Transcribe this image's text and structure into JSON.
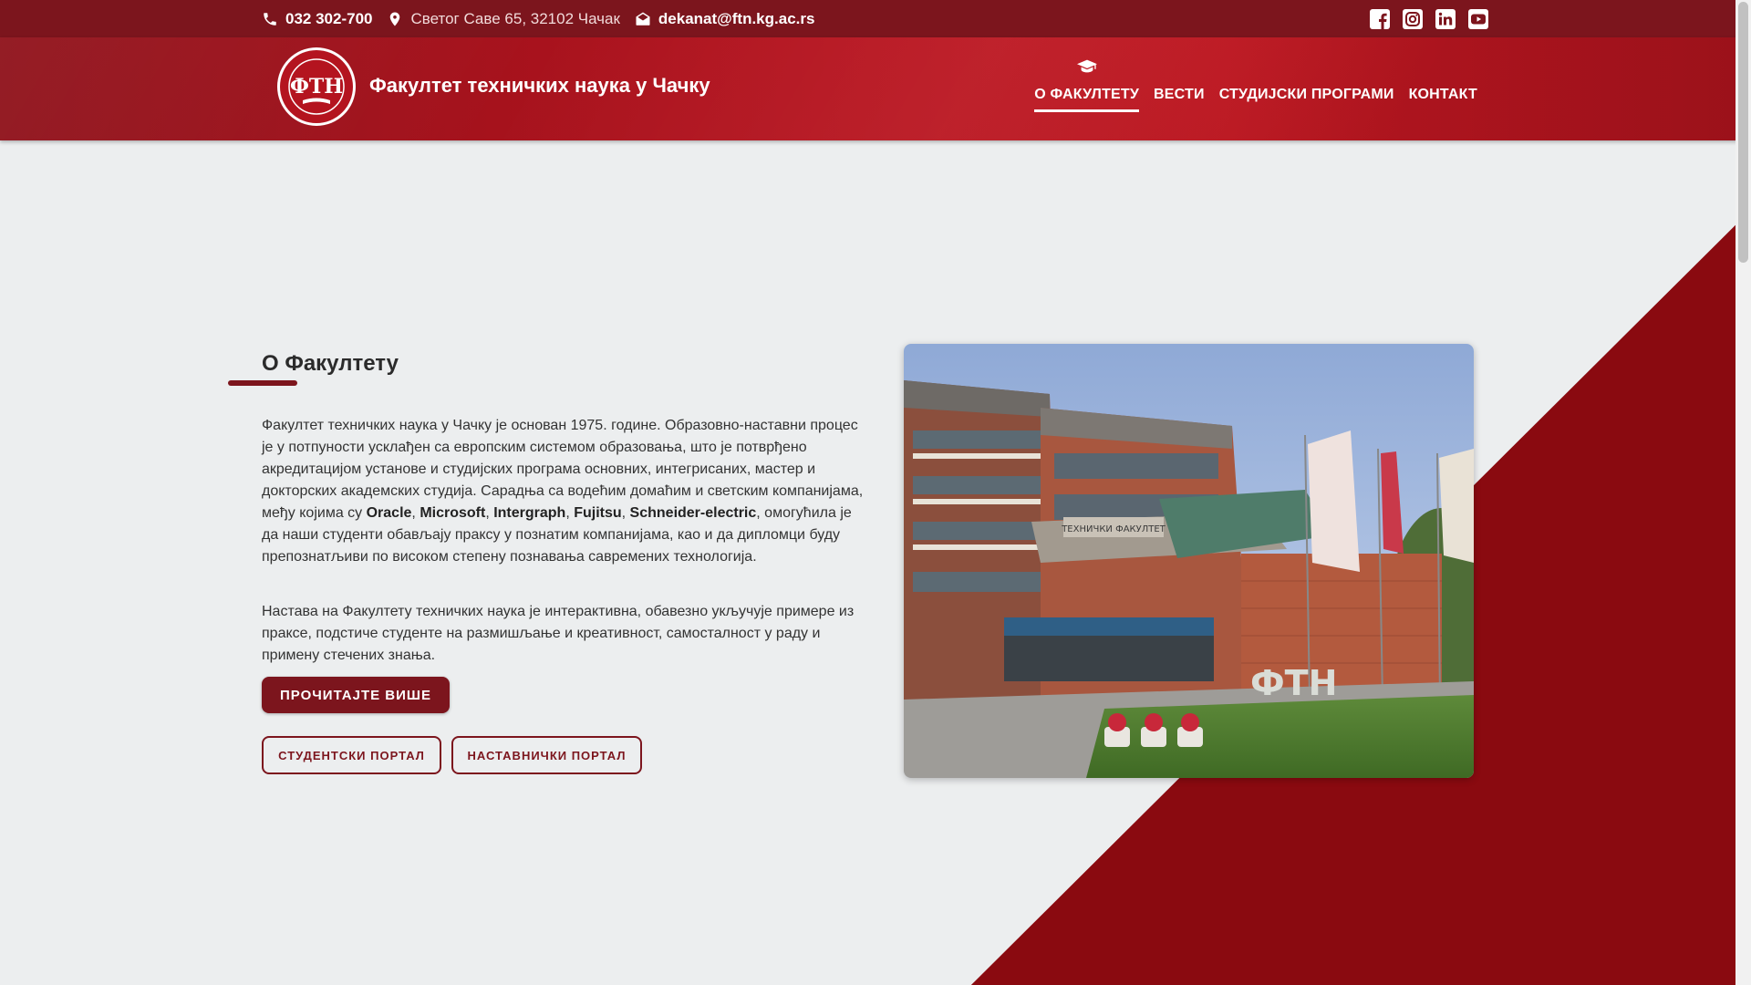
{
  "topbar": {
    "phone": "032 302-700",
    "address": "Светог Саве 65, 32102 Чачак",
    "email": "dekanat@ftn.kg.ac.rs",
    "social": [
      "facebook-icon",
      "instagram-icon",
      "linkedin-icon",
      "youtube-icon"
    ]
  },
  "header": {
    "site_title": "Факултет техничких наука у Чачку",
    "logo_text": "ФТН",
    "nav": [
      {
        "label": "О ФАКУЛТЕТУ",
        "active": true
      },
      {
        "label": "ВЕСТИ",
        "active": false
      },
      {
        "label": "СТУДИЈСКИ ПРОГРАМИ",
        "active": false
      },
      {
        "label": "КОНТАКТ",
        "active": false
      }
    ]
  },
  "about": {
    "title": "О Факултету",
    "para1_start": "Факултет техничких наука у Чачку је основан 1975. године. Образовно-наставни процес је у потпуности усклађен са европским системом образовања, што је потврђено акредитацијом установе и студијских програма основних, интегрисаних, мастер и докторских академских студија. Сарадња са водећим домаћим и светским компанијама, међу којима су ",
    "companies": [
      "Oracle",
      "Microsoft",
      "Intergraph",
      "Fujitsu",
      "Schneider-electric"
    ],
    "para1_end": ", омогућила је да наши студенти обављају праксу у познатим компанијама, као и да дипломци буду препознатљиви по високом степену познавања савремених технологија.",
    "para2": "Настава на Факултету техничких наука је интерактивна, обавезно укључује примере из праксе, подстиче студенте на размишљање и креативност, самосталност у раду и примену стечених знања.",
    "read_more": "ПРОЧИТАЈТЕ ВИШЕ",
    "student_portal": "СТУДЕНТСКИ ПОРТАЛ",
    "teacher_portal": "НАСТАВНИЧКИ ПОРТАЛ"
  },
  "photo": {
    "building_sign": "ТЕХНИЧКИ ФАКУЛТЕТ",
    "hedge_letters": "ФТН"
  },
  "colors": {
    "brand": "#7c151d",
    "header_red": "#b4141f",
    "decor_red": "#8a0a10",
    "background": "#eceeef"
  }
}
